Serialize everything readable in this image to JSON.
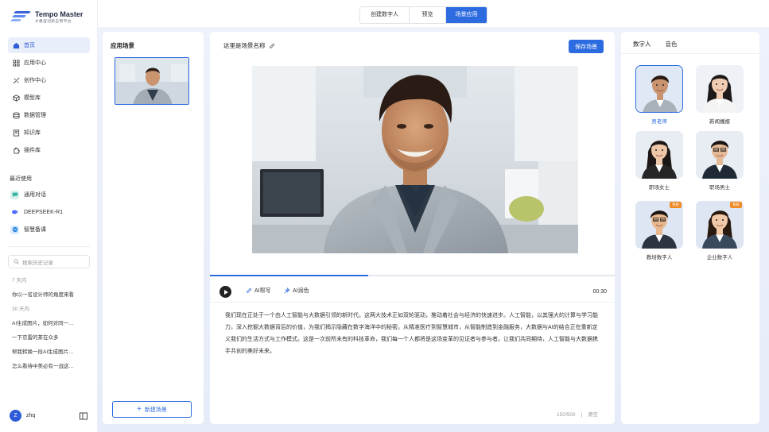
{
  "app": {
    "title": "Tempo Master",
    "subtitle": "大模型创新应用平台"
  },
  "nav": [
    {
      "label": "首页",
      "icon": "home-icon",
      "active": true
    },
    {
      "label": "应用中心",
      "icon": "apps-icon"
    },
    {
      "label": "创作中心",
      "icon": "create-icon"
    },
    {
      "label": "模型库",
      "icon": "cube-icon"
    },
    {
      "label": "数据管理",
      "icon": "database-icon"
    },
    {
      "label": "知识库",
      "icon": "book-icon"
    },
    {
      "label": "插件库",
      "icon": "plugin-icon"
    }
  ],
  "recent": {
    "title": "最近使用",
    "items": [
      {
        "label": "通用对话",
        "icon": "chat-icon",
        "color": "#34b3a0"
      },
      {
        "label": "DEEPSEEK-R1",
        "icon": "deepseek-icon",
        "color": "#4d6bfe"
      },
      {
        "label": "智慧备课",
        "icon": "lesson-icon",
        "color": "#2f8ae6"
      }
    ]
  },
  "history": {
    "search_placeholder": "搜索历史记录",
    "groups": [
      {
        "label": "7 天内",
        "items": [
          "你以一名设计师的角度来看"
        ]
      },
      {
        "label": "30 天内",
        "items": [
          "AI生成图片，如何对同一…",
          "一下京雷的茶在众多",
          "帮我转换一段AI生成图片…",
          "怎么看待中美必有一战这…"
        ]
      }
    ]
  },
  "user": {
    "initial": "Z",
    "name": "zhq"
  },
  "top_tabs": [
    {
      "label": "创建数字人"
    },
    {
      "label": "预览"
    },
    {
      "label": "场景应用",
      "active": true
    }
  ],
  "scenes": {
    "title": "应用场景",
    "new_button": "新建场景"
  },
  "editor": {
    "scene_name": "这里是场景名称",
    "save_button": "保存场景",
    "progress": 0.39,
    "ai_write": "AI帮写",
    "ai_polish": "AI润色",
    "time": "00:30",
    "script": "我们现在正处于一个由人工智能与大数据引领的新时代。这两大技术正如双轮驱动，推动着社会与经济的快速进步。人工智能，以其强大的计算与学习能力，深入挖掘大数据背后的价值，为我们揭示隐藏在数字海洋中的秘密。从精准医疗到智慧城市，从智能制造到金融服务，大数据与AI的结合正在重新定义我们的生活方式与工作模式。这是一次前所未有的科技革命，我们每一个人都将是这场变革的见证者与参与者。让我们共同期待，人工智能与大数据携手共创的美好未来。",
    "count": "150/500",
    "clear": "清空"
  },
  "right": {
    "tabs": [
      {
        "label": "数字人",
        "active": true
      },
      {
        "label": "音色"
      }
    ],
    "avatars": [
      {
        "label": "男老师",
        "selected": true
      },
      {
        "label": "新闻播报"
      },
      {
        "label": "职场女士"
      },
      {
        "label": "职场男士"
      },
      {
        "label": "教培数字人",
        "tag": "系统"
      },
      {
        "label": "企业数字人",
        "tag": "系统"
      }
    ]
  },
  "colors": {
    "accent": "#2d6be0",
    "tag": "#f08a24"
  }
}
